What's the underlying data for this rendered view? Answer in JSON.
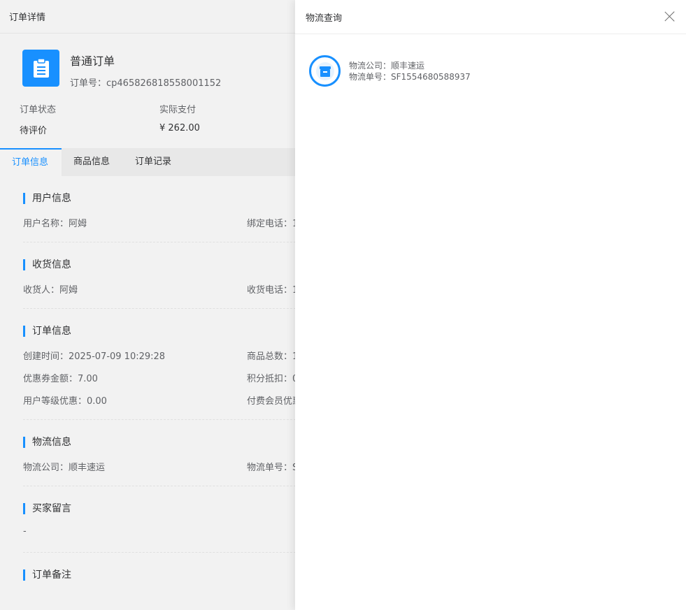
{
  "detail": {
    "header_title": "订单详情",
    "order_type": "普通订单",
    "order_no_label": "订单号：",
    "order_no": "cp465826818558001152",
    "status_label": "订单状态",
    "status_value": "待评价",
    "paid_label": "实际支付",
    "paid_value": "¥ 262.00",
    "tabs": [
      "订单信息",
      "商品信息",
      "订单记录"
    ],
    "sections": {
      "user": {
        "title": "用户信息",
        "name": "用户名称：阿姆",
        "phone": "绑定电话：1"
      },
      "receiver": {
        "title": "收货信息",
        "name": "收货人：阿姆",
        "phone": "收货电话：1"
      },
      "order": {
        "title": "订单信息",
        "created": "创建时间：2025-07-09 10:29:28",
        "total": "商品总数：1",
        "coupon": "优惠券金额：7.00",
        "points": "积分抵扣：0",
        "level": "用户等级优惠：0.00",
        "member": "付费会员优惠"
      },
      "logistics": {
        "title": "物流信息",
        "company": "物流公司：顺丰速运",
        "number": "物流单号：S"
      },
      "message": {
        "title": "买家留言",
        "value": "-"
      },
      "remark": {
        "title": "订单备注"
      }
    }
  },
  "drawer": {
    "title": "物流查询",
    "company_label": "物流公司：",
    "company": "顺丰速运",
    "number_label": "物流单号：",
    "number": "SF1554680588937"
  },
  "colors": {
    "accent": "#1890ff"
  }
}
